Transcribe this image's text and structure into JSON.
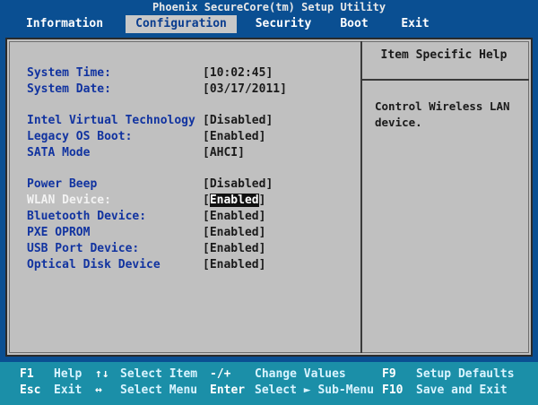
{
  "title": "Phoenix SecureCore(tm) Setup Utility",
  "menu": [
    {
      "label": "Information"
    },
    {
      "label": "Configuration"
    },
    {
      "label": "Security"
    },
    {
      "label": "Boot"
    },
    {
      "label": "Exit"
    }
  ],
  "settings": [
    {
      "label": "System Time:",
      "value": "[10:02:45]"
    },
    {
      "label": "System Date:",
      "value": "[03/17/2011]"
    },
    {
      "label": "Intel Virtual Technology",
      "value": "[Disabled]"
    },
    {
      "label": "Legacy OS Boot:",
      "value": "[Enabled]"
    },
    {
      "label": "SATA Mode",
      "value": "[AHCI]"
    },
    {
      "label": "Power Beep",
      "value": "[Disabled]"
    },
    {
      "label": "WLAN Device:",
      "value": "Enabled"
    },
    {
      "label": "Bluetooth Device:",
      "value": "[Enabled]"
    },
    {
      "label": "PXE OPROM",
      "value": "[Enabled]"
    },
    {
      "label": "USB Port Device:",
      "value": "[Enabled]"
    },
    {
      "label": "Optical Disk Device",
      "value": "[Enabled]"
    }
  ],
  "help": {
    "title": "Item Specific Help",
    "text": "Control Wireless LAN device."
  },
  "footer": {
    "row1": [
      {
        "key": "F1",
        "desc": "Help"
      },
      {
        "key": "↑↓",
        "desc": "Select Item"
      },
      {
        "key": "-/+",
        "desc": "Change Values"
      },
      {
        "key": "F9",
        "desc": "Setup Defaults"
      }
    ],
    "row2": [
      {
        "key": "Esc",
        "desc": "Exit"
      },
      {
        "key": "↔",
        "desc": "Select Menu"
      },
      {
        "key": "Enter",
        "desc": "Select ► Sub-Menu"
      },
      {
        "key": "F10",
        "desc": "Save and Exit"
      }
    ]
  },
  "colors": {
    "background": "#0a4f92",
    "panel": "#c0c0c0",
    "footer": "#1b8fa8",
    "label": "#1133a0"
  }
}
